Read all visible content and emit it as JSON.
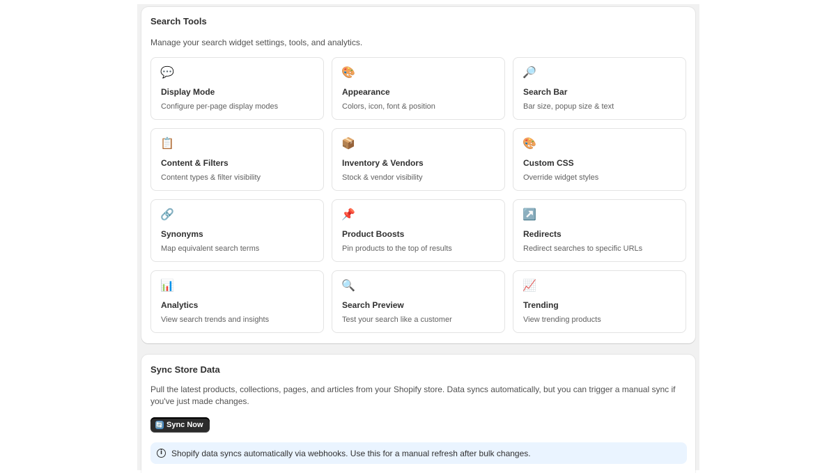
{
  "search_tools": {
    "title": "Search Tools",
    "subtitle": "Manage your search widget settings, tools, and analytics.",
    "tiles": [
      {
        "icon": "speech-bubble-icon",
        "glyph": "💬",
        "title": "Display Mode",
        "desc": "Configure per-page display modes"
      },
      {
        "icon": "palette-icon",
        "glyph": "🎨",
        "title": "Appearance",
        "desc": "Colors, icon, font & position"
      },
      {
        "icon": "magnifier-icon",
        "glyph": "🔎",
        "title": "Search Bar",
        "desc": "Bar size, popup size & text"
      },
      {
        "icon": "clipboard-icon",
        "glyph": "📋",
        "title": "Content & Filters",
        "desc": "Content types & filter visibility"
      },
      {
        "icon": "package-icon",
        "glyph": "📦",
        "title": "Inventory & Vendors",
        "desc": "Stock & vendor visibility"
      },
      {
        "icon": "palette-icon",
        "glyph": "🎨",
        "title": "Custom CSS",
        "desc": "Override widget styles"
      },
      {
        "icon": "link-icon",
        "glyph": "🔗",
        "title": "Synonyms",
        "desc": "Map equivalent search terms"
      },
      {
        "icon": "pushpin-icon",
        "glyph": "📌",
        "title": "Product Boosts",
        "desc": "Pin products to the top of results"
      },
      {
        "icon": "arrow-up-right-icon",
        "glyph": "↗️",
        "title": "Redirects",
        "desc": "Redirect searches to specific URLs"
      },
      {
        "icon": "bar-chart-icon",
        "glyph": "📊",
        "title": "Analytics",
        "desc": "View search trends and insights"
      },
      {
        "icon": "magnifier-icon",
        "glyph": "🔍",
        "title": "Search Preview",
        "desc": "Test your search like a customer"
      },
      {
        "icon": "trend-chart-icon",
        "glyph": "📈",
        "title": "Trending",
        "desc": "View trending products"
      }
    ]
  },
  "sync": {
    "title": "Sync Store Data",
    "description": "Pull the latest products, collections, pages, and articles from your Shopify store. Data syncs automatically, but you can trigger a manual sync if you've just made changes.",
    "button_label": "Sync Now",
    "button_glyph": "🔄",
    "info_glyph": "i",
    "info_text": "Shopify data syncs automatically via webhooks. Use this for a manual refresh after bulk changes."
  }
}
